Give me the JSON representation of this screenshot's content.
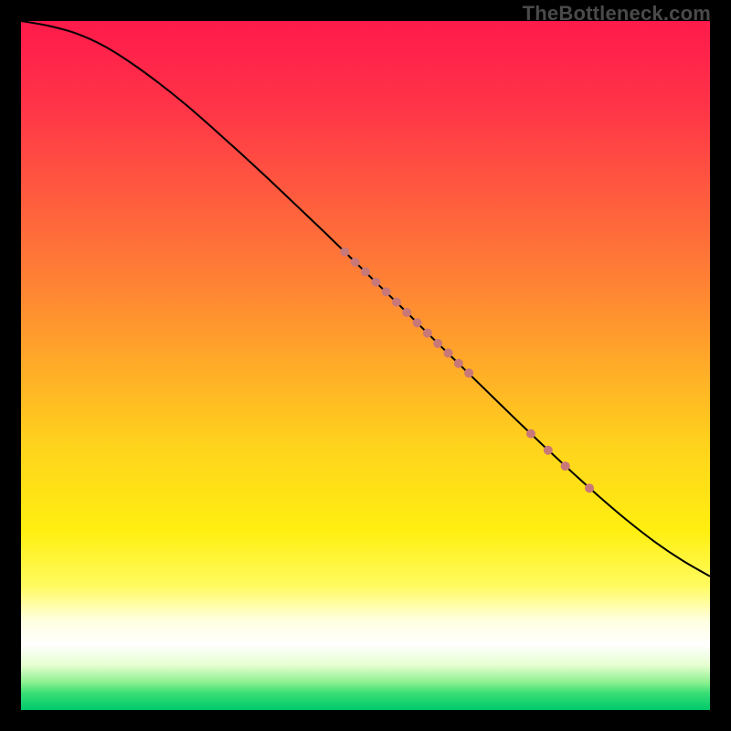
{
  "watermark": "TheBottleneck.com",
  "chart_data": {
    "type": "line",
    "title": "",
    "xlabel": "",
    "ylabel": "",
    "xlim": [
      0,
      100
    ],
    "ylim": [
      0,
      100
    ],
    "grid": false,
    "background_gradient": {
      "stops": [
        {
          "pos": 0.0,
          "color": "#ff1a4b"
        },
        {
          "pos": 0.12,
          "color": "#ff3348"
        },
        {
          "pos": 0.25,
          "color": "#ff5a3f"
        },
        {
          "pos": 0.38,
          "color": "#ff8234"
        },
        {
          "pos": 0.5,
          "color": "#ffab28"
        },
        {
          "pos": 0.62,
          "color": "#ffd41c"
        },
        {
          "pos": 0.74,
          "color": "#ffef10"
        },
        {
          "pos": 0.82,
          "color": "#fffb60"
        },
        {
          "pos": 0.87,
          "color": "#ffffe0"
        },
        {
          "pos": 0.905,
          "color": "#ffffff"
        },
        {
          "pos": 0.935,
          "color": "#e6ffd0"
        },
        {
          "pos": 0.96,
          "color": "#8cf090"
        },
        {
          "pos": 0.975,
          "color": "#3adf75"
        },
        {
          "pos": 1.0,
          "color": "#00c96b"
        }
      ]
    },
    "series": [
      {
        "name": "curve",
        "color": "#000000",
        "stroke_width": 2,
        "x": [
          0,
          4,
          8,
          12,
          16,
          20,
          24,
          28,
          32,
          36,
          40,
          44,
          48,
          52,
          56,
          60,
          64,
          68,
          72,
          76,
          80,
          84,
          88,
          92,
          96,
          100
        ],
        "y": [
          100.0,
          99.3,
          98.2,
          96.4,
          93.9,
          91.0,
          87.8,
          84.3,
          80.7,
          77.0,
          73.2,
          69.4,
          65.5,
          61.6,
          57.7,
          53.7,
          49.8,
          45.9,
          42.0,
          38.2,
          34.5,
          30.9,
          27.5,
          24.4,
          21.7,
          19.4
        ]
      }
    ],
    "markers": {
      "name": "highlight-points",
      "color": "#c97878",
      "radius": 5,
      "points": [
        {
          "x": 47.0,
          "y": 66.5
        },
        {
          "x": 48.5,
          "y": 65.0
        },
        {
          "x": 50.0,
          "y": 63.6
        },
        {
          "x": 51.5,
          "y": 62.1
        },
        {
          "x": 53.0,
          "y": 60.7
        },
        {
          "x": 54.5,
          "y": 59.2
        },
        {
          "x": 56.0,
          "y": 57.7
        },
        {
          "x": 57.5,
          "y": 56.2
        },
        {
          "x": 59.0,
          "y": 54.7
        },
        {
          "x": 60.5,
          "y": 53.2
        },
        {
          "x": 62.0,
          "y": 51.8
        },
        {
          "x": 63.5,
          "y": 50.3
        },
        {
          "x": 65.0,
          "y": 48.9
        },
        {
          "x": 74.0,
          "y": 40.1
        },
        {
          "x": 76.5,
          "y": 37.7
        },
        {
          "x": 79.0,
          "y": 35.4
        },
        {
          "x": 82.5,
          "y": 32.2
        }
      ]
    }
  }
}
